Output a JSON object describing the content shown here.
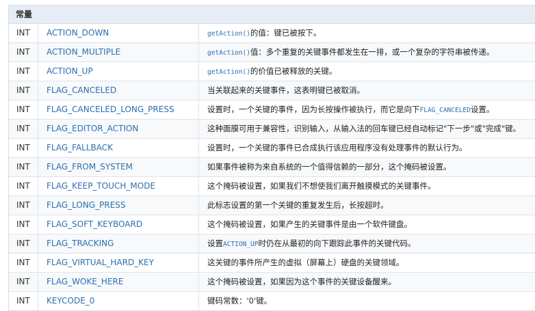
{
  "table": {
    "header": "常量",
    "rows": [
      {
        "type": "INT",
        "name": "ACTION_DOWN",
        "code": "getAction()",
        "desc": "的值：键已被按下。"
      },
      {
        "type": "INT",
        "name": "ACTION_MULTIPLE",
        "code": "getAction()",
        "desc": "值：多个重复的关键事件都发生在一排，或一个复杂的字符串被传递。"
      },
      {
        "type": "INT",
        "name": "ACTION_UP",
        "code": "getAction()",
        "desc": "的价值已被释放的关键。"
      },
      {
        "type": "INT",
        "name": "FLAG_CANCELED",
        "desc": "当关联起来的关键事件，这表明键已被取消。"
      },
      {
        "type": "INT",
        "name": "FLAG_CANCELED_LONG_PRESS",
        "pre": "设置时，一个关键的事件，因为长按操作被执行，而它是向下",
        "code": "FLAG_CANCELED",
        "post": "设置。"
      },
      {
        "type": "INT",
        "name": "FLAG_EDITOR_ACTION",
        "desc": "这种面膜可用于兼容性，识别输入，从输入法的回车键已经自动标记\"下一步\"或\"完成\"键。"
      },
      {
        "type": "INT",
        "name": "FLAG_FALLBACK",
        "desc": "设置时，一个关键的事件已合成执行该应用程序没有处理事件的默认行为。"
      },
      {
        "type": "INT",
        "name": "FLAG_FROM_SYSTEM",
        "desc": "如果事件被称为来自系统的一个值得信赖的一部分，这个掩码被设置。"
      },
      {
        "type": "INT",
        "name": "FLAG_KEEP_TOUCH_MODE",
        "desc": "这个掩码被设置，如果我们不想使我们离开触摸模式的关键事件。"
      },
      {
        "type": "INT",
        "name": "FLAG_LONG_PRESS",
        "desc": "此标志设置的第一个关键的重复发生后，长按超时。"
      },
      {
        "type": "INT",
        "name": "FLAG_SOFT_KEYBOARD",
        "desc": "这个掩码被设置，如果产生的关键事件是由一个软件键盘。"
      },
      {
        "type": "INT",
        "name": "FLAG_TRACKING",
        "pre": "设置",
        "code": "ACTION_UP",
        "post": "时仍在从最初的向下跟踪此事件的关键代码。"
      },
      {
        "type": "INT",
        "name": "FLAG_VIRTUAL_HARD_KEY",
        "desc": "这关键的事件所产生的虚拟（屏幕上）硬盘的关键领域。"
      },
      {
        "type": "INT",
        "name": "FLAG_WOKE_HERE",
        "desc": "这个掩码被设置，如果因为这个事件的关键设备醒来。"
      },
      {
        "type": "INT",
        "name": "KEYCODE_0",
        "desc": "键码常数：'0'键。"
      }
    ]
  }
}
